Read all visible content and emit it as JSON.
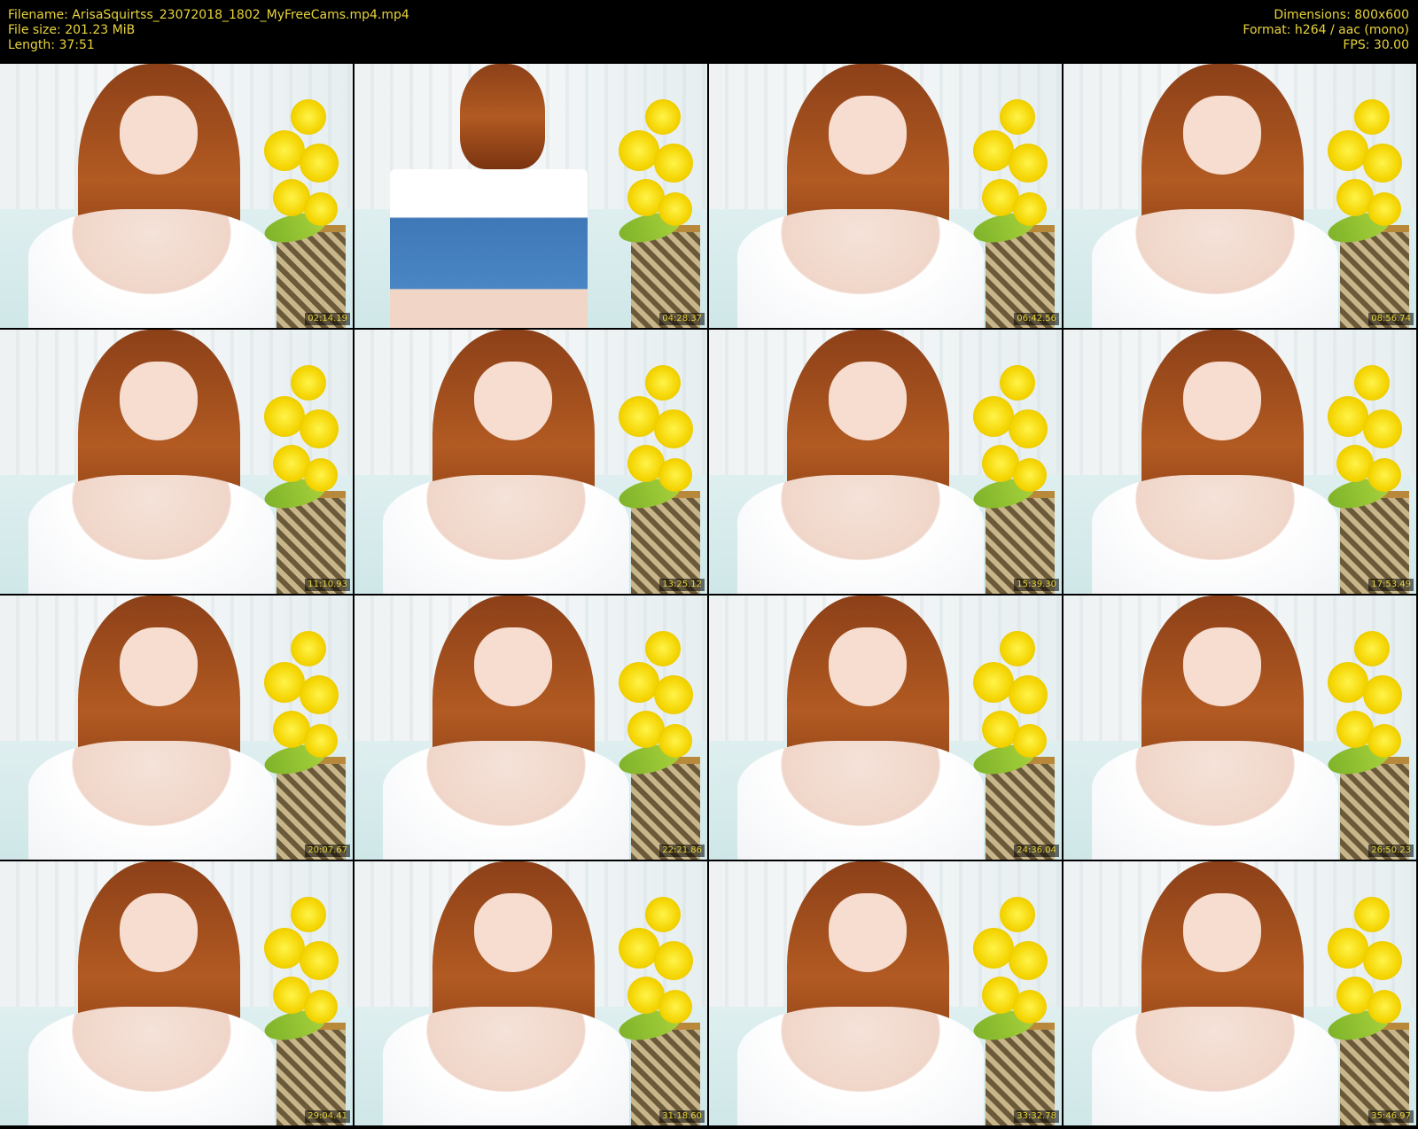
{
  "header": {
    "filename": "Filename: ArisaSquirtss_23072018_1802_MyFreeCams.mp4.mp4",
    "filesize": "File size: 201.23 MiB",
    "length": "Length: 37:51",
    "dimensions": "Dimensions: 800x600",
    "format": "Format: h264 / aac (mono)",
    "fps": "FPS: 30.00"
  },
  "colors": {
    "header_text": "#e8d43a",
    "background": "#000000"
  },
  "thumbnails": [
    {
      "timestamp": "02:14.19"
    },
    {
      "timestamp": "04:28.37"
    },
    {
      "timestamp": "06:42.56"
    },
    {
      "timestamp": "08:56.74"
    },
    {
      "timestamp": "11:10.93"
    },
    {
      "timestamp": "13:25.12"
    },
    {
      "timestamp": "15:39.30"
    },
    {
      "timestamp": "17:53.49"
    },
    {
      "timestamp": "20:07.67"
    },
    {
      "timestamp": "22:21.86"
    },
    {
      "timestamp": "24:36.04"
    },
    {
      "timestamp": "26:50.23"
    },
    {
      "timestamp": "29:04.41"
    },
    {
      "timestamp": "31:18.60"
    },
    {
      "timestamp": "33:32.78"
    },
    {
      "timestamp": "35:46.97"
    }
  ]
}
